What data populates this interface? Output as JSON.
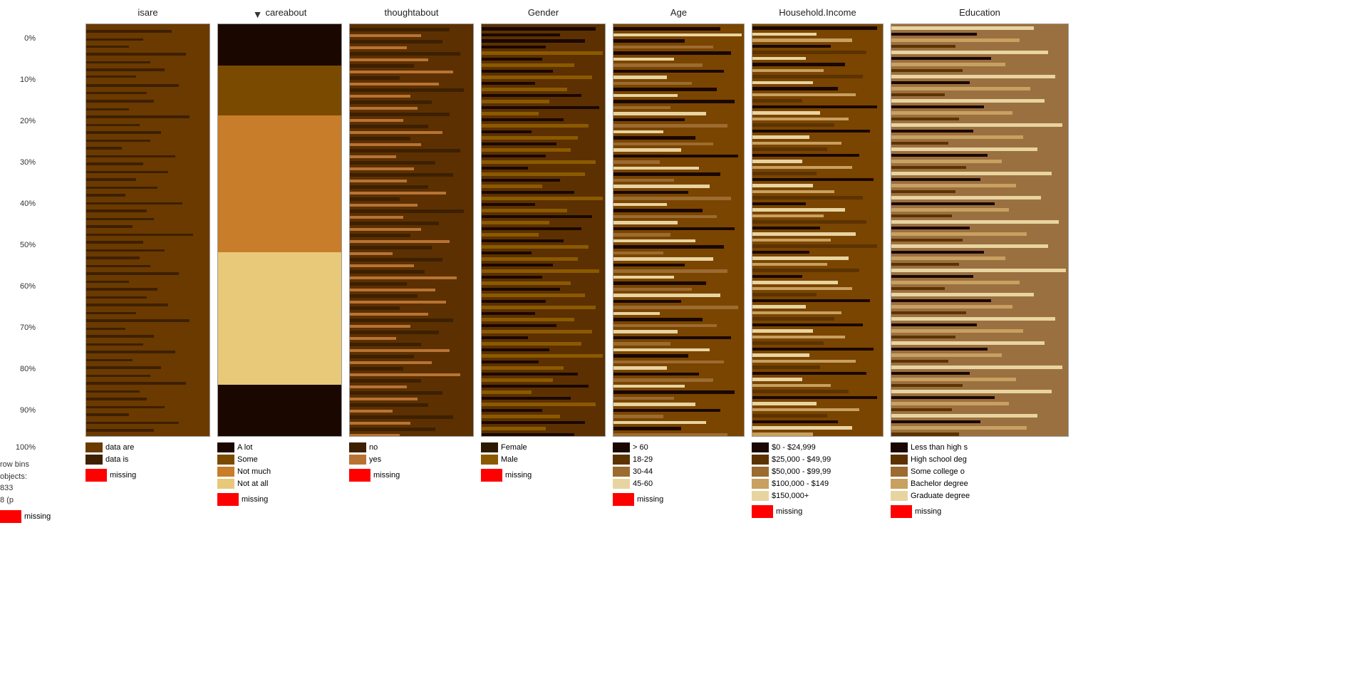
{
  "chart": {
    "yAxis": {
      "labels": [
        "0%",
        "10%",
        "20%",
        "30%",
        "40%",
        "50%",
        "60%",
        "70%",
        "80%",
        "90%",
        "100%"
      ]
    },
    "columns": [
      {
        "id": "isare",
        "title": "isare",
        "hasTriangle": false,
        "type": "horizontal_bars",
        "barColor": "#6B3A00",
        "darkColor": "#3D2000",
        "legend": [
          {
            "label": "data are",
            "color": "#6B3A00"
          },
          {
            "label": "data is",
            "color": "#3D2000"
          }
        ]
      },
      {
        "id": "careabout",
        "title": "careabout",
        "hasTriangle": true,
        "type": "stacked",
        "segments": [
          {
            "color": "#2C1A00",
            "pct": 10
          },
          {
            "color": "#8B5A00",
            "pct": 12
          },
          {
            "color": "#C87D2A",
            "pct": 33
          },
          {
            "color": "#E8C97A",
            "pct": 32
          },
          {
            "color": "#2C1A00",
            "pct": 13
          }
        ],
        "legend": [
          {
            "label": "A lot",
            "color": "#2C1A00"
          },
          {
            "label": "Some",
            "color": "#8B5A00"
          },
          {
            "label": "Not much",
            "color": "#C87D2A"
          },
          {
            "label": "Not at all",
            "color": "#E8C97A"
          }
        ]
      },
      {
        "id": "thoughtabout",
        "title": "thoughtabout",
        "hasTriangle": false,
        "type": "noisy_stacked",
        "legend": [
          {
            "label": "no",
            "color": "#3D2000"
          },
          {
            "label": "yes",
            "color": "#B87333"
          }
        ]
      },
      {
        "id": "gender",
        "title": "Gender",
        "hasTriangle": false,
        "type": "noisy_stacked",
        "legend": [
          {
            "label": "Female",
            "color": "#2C1A00"
          },
          {
            "label": "Male",
            "color": "#8B5A00"
          }
        ]
      },
      {
        "id": "age",
        "title": "Age",
        "hasTriangle": false,
        "type": "noisy_stacked",
        "legend": [
          {
            "label": "> 60",
            "color": "#1A0A00"
          },
          {
            "label": "18-29",
            "color": "#5C3300"
          },
          {
            "label": "30-44",
            "color": "#9B6B30"
          },
          {
            "label": "45-60",
            "color": "#E8D4A0"
          }
        ]
      },
      {
        "id": "income",
        "title": "Household.Income",
        "hasTriangle": false,
        "type": "noisy_stacked",
        "legend": [
          {
            "label": "$0 - $24,999",
            "color": "#1A0A00"
          },
          {
            "label": "$25,000 - $49,99",
            "color": "#5C3300"
          },
          {
            "label": "$50,000 - $99,99",
            "color": "#9B6B30"
          },
          {
            "label": "$100,000 - $149",
            "color": "#C8A060"
          },
          {
            "label": "$150,000+",
            "color": "#E8D4A0"
          }
        ]
      },
      {
        "id": "education",
        "title": "Education",
        "hasTriangle": false,
        "type": "noisy_stacked",
        "legend": [
          {
            "label": "Less than high s",
            "color": "#1A0A00"
          },
          {
            "label": "High school deg",
            "color": "#5C3300"
          },
          {
            "label": "Some college o",
            "color": "#9B6B30"
          },
          {
            "label": "Bachelor degree",
            "color": "#C8A060"
          },
          {
            "label": "Graduate degree",
            "color": "#E8D4A0"
          }
        ]
      }
    ],
    "info": {
      "rowBins": "row bins",
      "objects": "objects:",
      "count": "833",
      "pLabel": "8 (p",
      "missingLabel": "missing"
    }
  }
}
